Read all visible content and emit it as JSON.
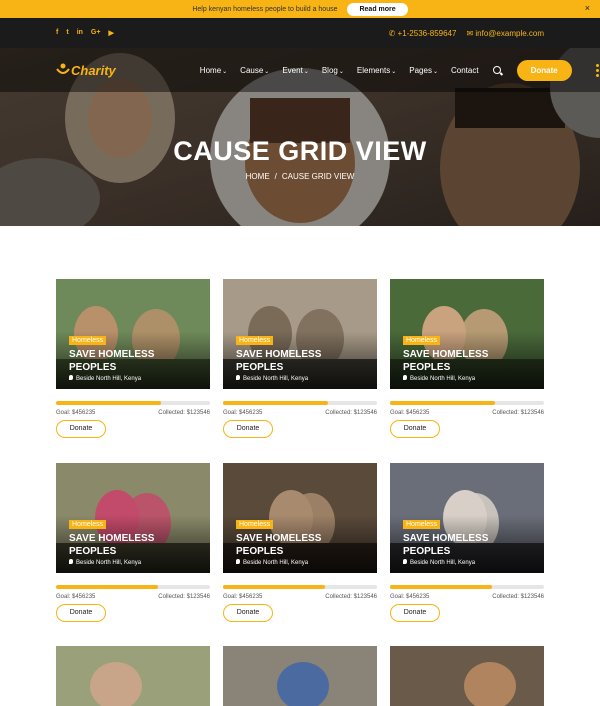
{
  "announcement": {
    "text": "Help kenyan homeless people to build a house",
    "button": "Read more",
    "close": "×"
  },
  "contact": {
    "phone": "+1-2536-859647",
    "email": "info@example.com"
  },
  "social_icons": [
    "facebook-icon",
    "twitter-icon",
    "linkedin-icon",
    "google-plus-icon",
    "youtube-icon"
  ],
  "social_glyphs": [
    "f",
    "t",
    "in",
    "G+",
    "▶"
  ],
  "logo": {
    "text": "Charity"
  },
  "nav": {
    "items": [
      {
        "label": "Home",
        "dropdown": true
      },
      {
        "label": "Cause",
        "dropdown": true
      },
      {
        "label": "Event",
        "dropdown": true
      },
      {
        "label": "Blog",
        "dropdown": true
      },
      {
        "label": "Elements",
        "dropdown": true
      },
      {
        "label": "Pages",
        "dropdown": true
      },
      {
        "label": "Contact",
        "dropdown": false
      }
    ],
    "donate": "Donate"
  },
  "hero": {
    "title": "CAUSE GRID VIEW",
    "breadcrumb": [
      "HOME",
      "CAUSE GRID VIEW"
    ],
    "separator": "/"
  },
  "colors": {
    "accent": "#f7b414",
    "dark": "#1b1b1b"
  },
  "causes": [
    {
      "tag": "Homeless",
      "title": "SAVE HOMELESS PEOPLES",
      "location": "Beside North Hill, Kenya",
      "goal": "Goal: $456235",
      "collected": "Collected: $123546",
      "progress": 0.68,
      "button": "Donate"
    },
    {
      "tag": "Homeless",
      "title": "SAVE HOMELESS PEOPLES",
      "location": "Beside North Hill, Kenya",
      "goal": "Goal: $456235",
      "collected": "Collected: $123546",
      "progress": 0.68,
      "button": "Donate"
    },
    {
      "tag": "Homeless",
      "title": "SAVE HOMELESS PEOPLES",
      "location": "Beside North Hill, Kenya",
      "goal": "Goal: $456235",
      "collected": "Collected: $123546",
      "progress": 0.68,
      "button": "Donate"
    },
    {
      "tag": "Homeless",
      "title": "SAVE HOMELESS PEOPLES",
      "location": "Beside North Hill, Kenya",
      "goal": "Goal: $456235",
      "collected": "Collected: $123546",
      "progress": 0.66,
      "button": "Donate"
    },
    {
      "tag": "Homeless",
      "title": "SAVE HOMELESS PEOPLES",
      "location": "Beside North Hill, Kenya",
      "goal": "Goal: $456235",
      "collected": "Collected: $123546",
      "progress": 0.66,
      "button": "Donate"
    },
    {
      "tag": "Homeless",
      "title": "SAVE HOMELESS PEOPLES",
      "location": "Beside North Hill, Kenya",
      "goal": "Goal: $456235",
      "collected": "Collected: $123546",
      "progress": 0.66,
      "button": "Donate"
    }
  ]
}
